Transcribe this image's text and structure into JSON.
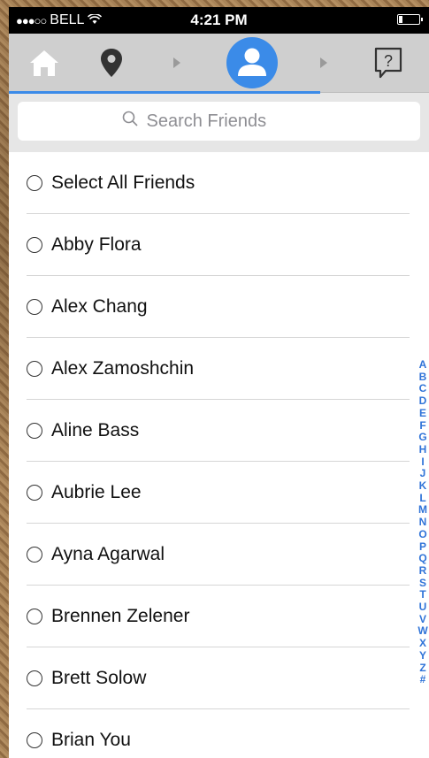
{
  "status_bar": {
    "signal_dots": "●●●○○",
    "carrier": "BELL",
    "wifi_icon": "wifi-icon",
    "time": "4:21 PM",
    "battery_level": 0.2
  },
  "nav": {
    "steps": [
      {
        "name": "home",
        "icon": "home-icon"
      },
      {
        "name": "location",
        "icon": "map-pin-icon"
      },
      {
        "name": "friends",
        "icon": "user-icon",
        "active": true
      },
      {
        "name": "help",
        "icon": "help-icon"
      }
    ],
    "progress_fraction": 0.74,
    "active_color": "#3b8be8"
  },
  "search": {
    "placeholder": "Search Friends",
    "value": ""
  },
  "friends": {
    "select_all_label": "Select All Friends",
    "items": [
      "Abby Flora",
      "Alex Chang",
      "Alex Zamoshchin",
      "Aline Bass",
      "Aubrie Lee",
      "Ayna Agarwal",
      "Brennen Zelener",
      "Brett Solow",
      "Brian You"
    ]
  },
  "index_letters": [
    "A",
    "B",
    "C",
    "D",
    "E",
    "F",
    "G",
    "H",
    "I",
    "J",
    "K",
    "L",
    "M",
    "N",
    "O",
    "P",
    "Q",
    "R",
    "S",
    "T",
    "U",
    "V",
    "W",
    "X",
    "Y",
    "Z",
    "#"
  ],
  "colors": {
    "accent": "#3b8be8",
    "index": "#2f73d8"
  }
}
